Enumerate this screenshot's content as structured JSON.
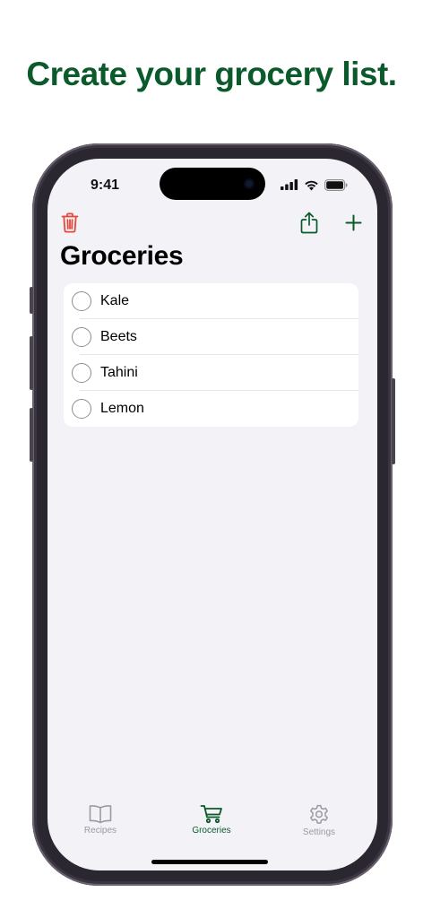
{
  "colors": {
    "accent": "#0b5a2b",
    "destructive": "#e5483b",
    "inactive": "#9a9aa0"
  },
  "headline": "Create your grocery list.",
  "status_bar": {
    "time": "9:41"
  },
  "toolbar": {
    "trash_icon": "trash-icon",
    "share_icon": "share-icon",
    "add_icon": "plus-icon"
  },
  "page": {
    "title": "Groceries"
  },
  "items": [
    {
      "label": "Kale",
      "checked": false
    },
    {
      "label": "Beets",
      "checked": false
    },
    {
      "label": "Tahini",
      "checked": false
    },
    {
      "label": "Lemon",
      "checked": false
    }
  ],
  "tabs": [
    {
      "label": "Recipes",
      "icon": "book-icon",
      "selected": false
    },
    {
      "label": "Groceries",
      "icon": "cart-icon",
      "selected": true
    },
    {
      "label": "Settings",
      "icon": "gear-icon",
      "selected": false
    }
  ]
}
